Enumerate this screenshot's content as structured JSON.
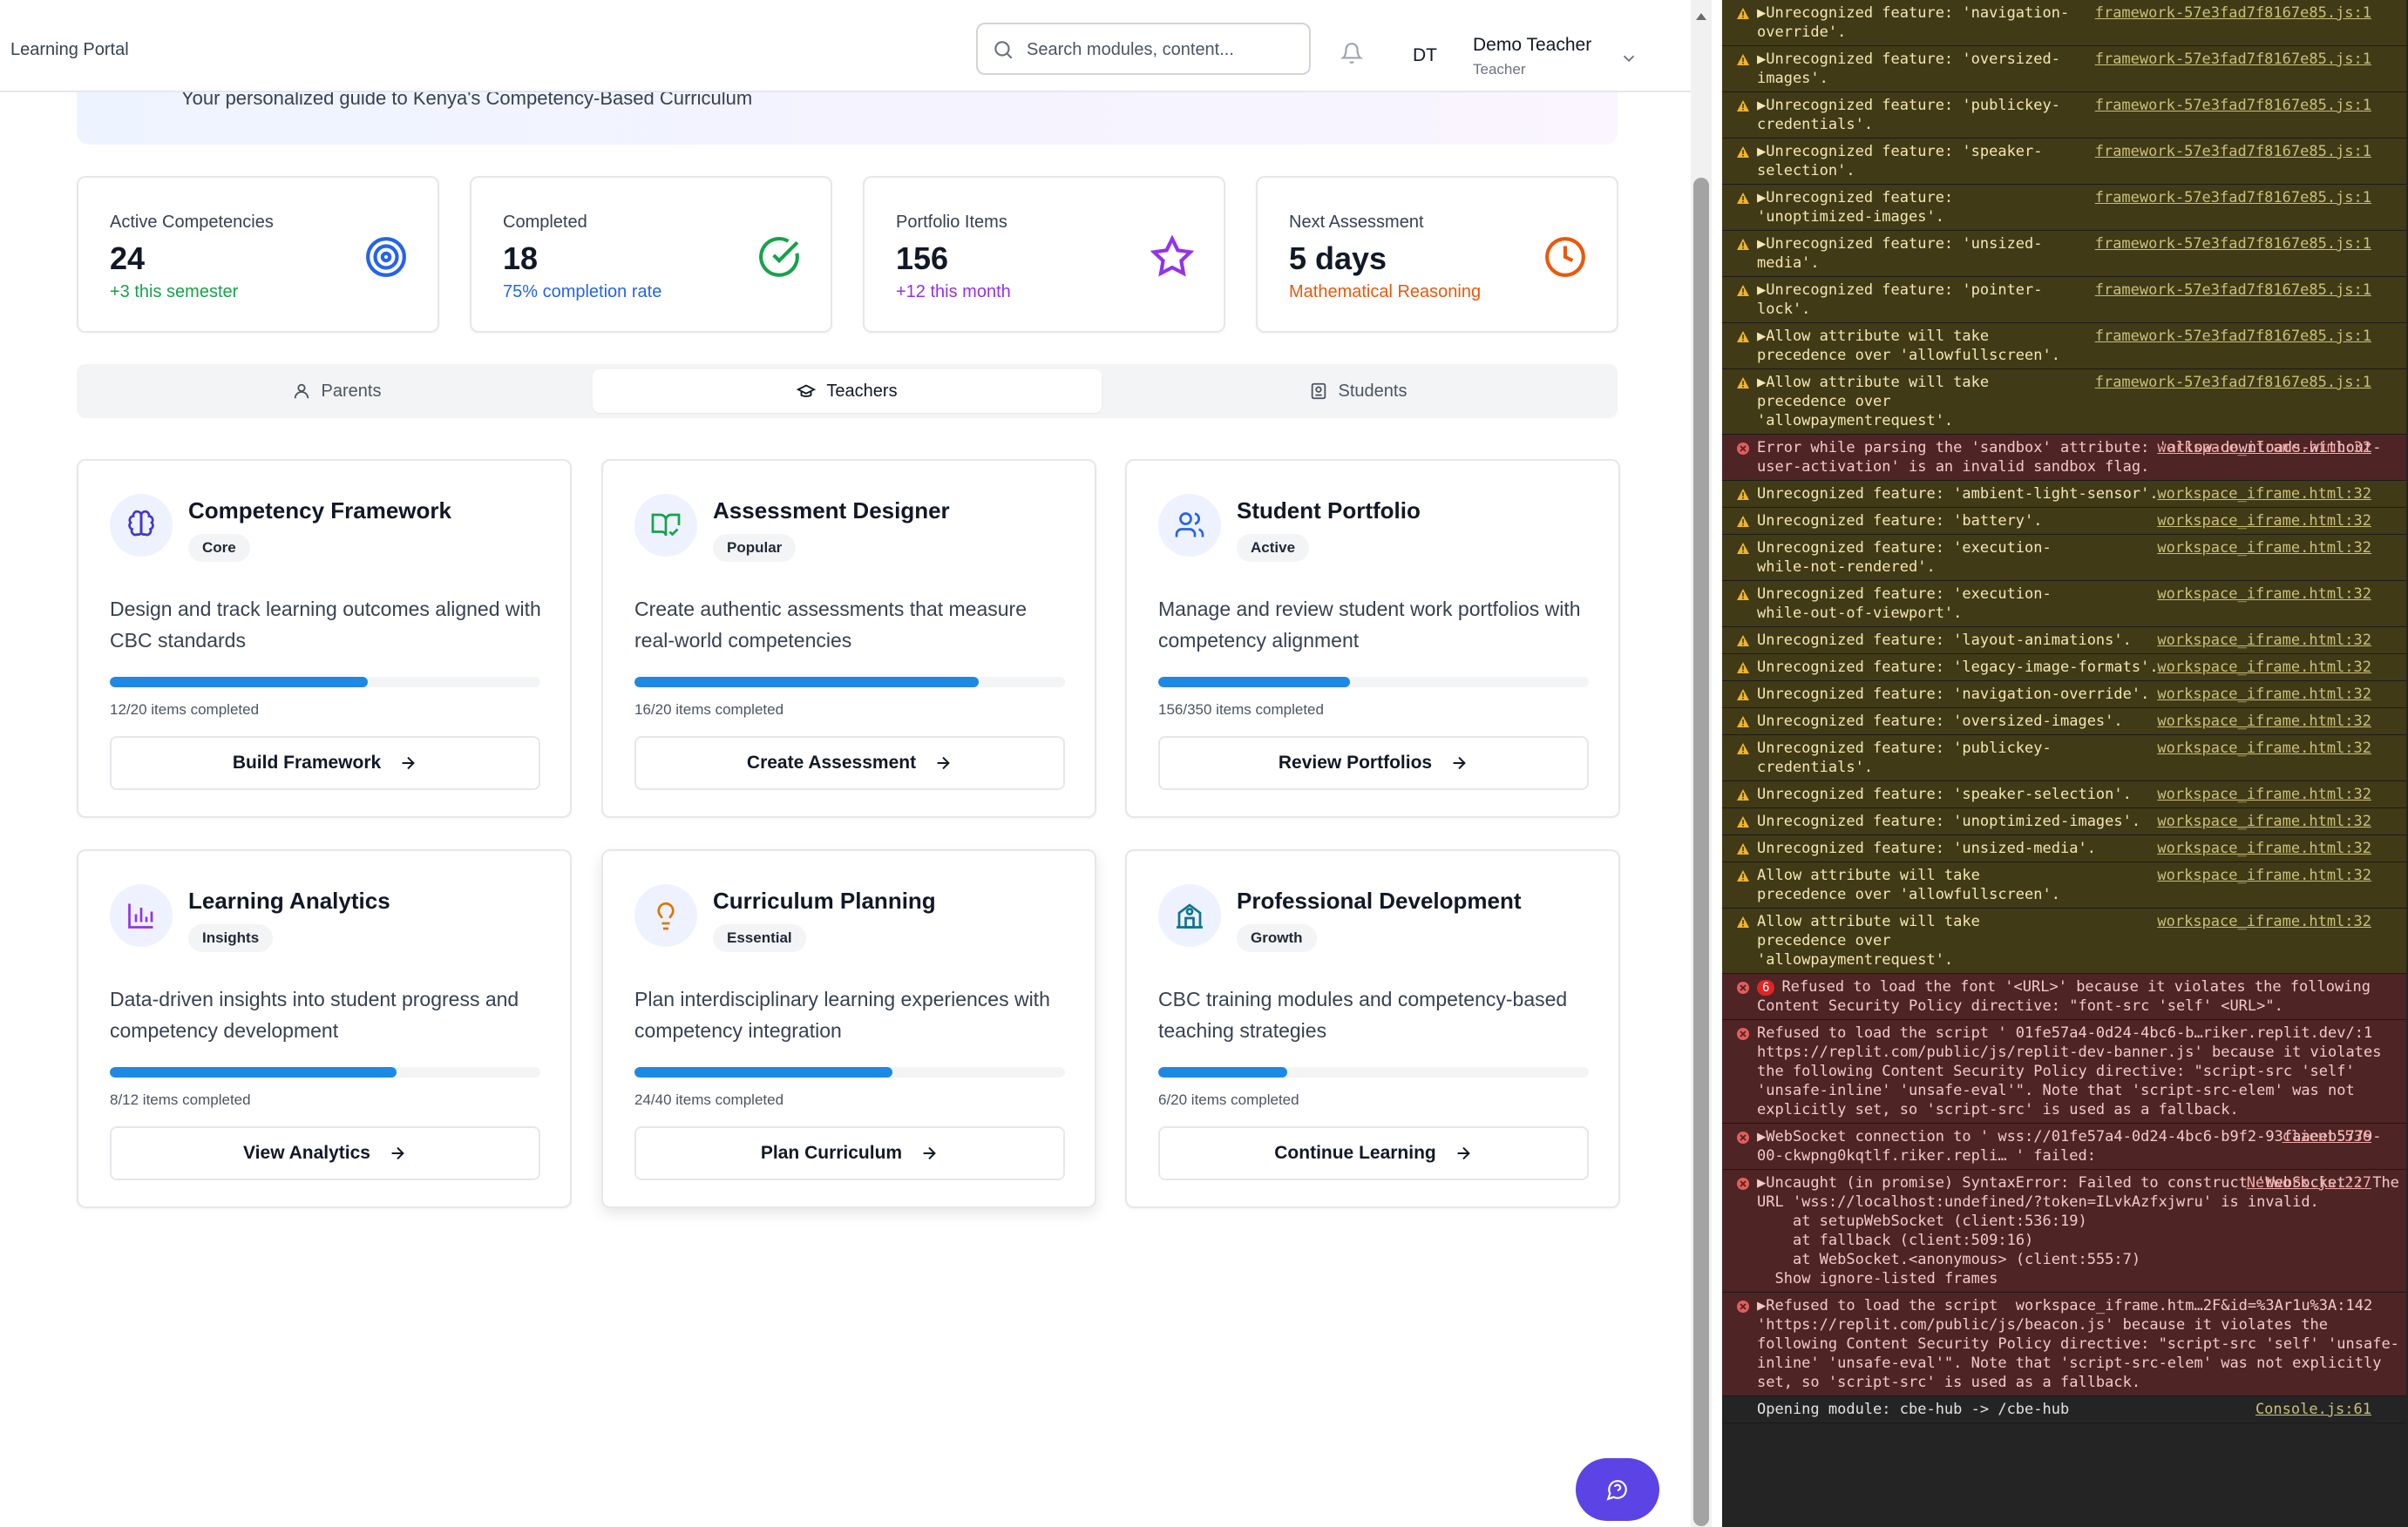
{
  "header": {
    "brand": "Learning Portal",
    "search_placeholder": "Search modules, content...",
    "user_initials": "DT",
    "user_name": "Demo Teacher",
    "user_role": "Teacher"
  },
  "hero": {
    "subtitle": "Your personalized guide to Kenya's Competency-Based Curriculum"
  },
  "stats": [
    {
      "label": "Active Competencies",
      "value": "24",
      "sub": "+3 this semester",
      "sub_color": "#16a34a",
      "icon": "target-icon",
      "icon_color": "#2563eb"
    },
    {
      "label": "Completed",
      "value": "18",
      "sub": "75% completion rate",
      "sub_color": "#2563eb",
      "icon": "check-circle-icon",
      "icon_color": "#16a34a"
    },
    {
      "label": "Portfolio Items",
      "value": "156",
      "sub": "+12 this month",
      "sub_color": "#9333ea",
      "icon": "star-icon",
      "icon_color": "#9333ea"
    },
    {
      "label": "Next Assessment",
      "value": "5 days",
      "sub": "Mathematical Reasoning",
      "sub_color": "#ea580c",
      "icon": "clock-icon",
      "icon_color": "#ea580c"
    }
  ],
  "tabs": [
    {
      "label": "Parents",
      "active": false
    },
    {
      "label": "Teachers",
      "active": true
    },
    {
      "label": "Students",
      "active": false
    }
  ],
  "modules": [
    {
      "title": "Competency Framework",
      "badge": "Core",
      "desc": "Design and track learning outcomes aligned with CBC standards",
      "progress": 0.6,
      "progress_text": "12/20 items completed",
      "button": "Build Framework",
      "icon": "brain-icon",
      "icon_color": "#4338ca"
    },
    {
      "title": "Assessment Designer",
      "badge": "Popular",
      "desc": "Create authentic assessments that measure real-world competencies",
      "progress": 0.8,
      "progress_text": "16/20 items completed",
      "button": "Create Assessment",
      "icon": "book-check-icon",
      "icon_color": "#16a34a"
    },
    {
      "title": "Student Portfolio",
      "badge": "Active",
      "desc": "Manage and review student work portfolios with competency alignment",
      "progress": 0.4457,
      "progress_text": "156/350 items completed",
      "button": "Review Portfolios",
      "icon": "users-icon",
      "icon_color": "#2563eb"
    },
    {
      "title": "Learning Analytics",
      "badge": "Insights",
      "desc": "Data-driven insights into student progress and competency development",
      "progress": 0.6667,
      "progress_text": "8/12 items completed",
      "button": "View Analytics",
      "icon": "bar-chart-icon",
      "icon_color": "#9333ea"
    },
    {
      "title": "Curriculum Planning",
      "badge": "Essential",
      "desc": "Plan interdisciplinary learning experiences with competency integration",
      "progress": 0.6,
      "progress_text": "24/40 items completed",
      "button": "Plan Curriculum",
      "icon": "lightbulb-icon",
      "icon_color": "#d97706"
    },
    {
      "title": "Professional Development",
      "badge": "Growth",
      "desc": "CBC training modules and competency-based teaching strategies",
      "progress": 0.3,
      "progress_text": "6/20 items completed",
      "button": "Continue Learning",
      "icon": "school-icon",
      "icon_color": "#0e7490"
    }
  ],
  "console": [
    {
      "level": "warn",
      "msg": "▶Unrecognized feature: 'navigation-override'.",
      "src": "framework-57e3fad7f8167e85.js:1",
      "narrow": true
    },
    {
      "level": "warn",
      "msg": "▶Unrecognized feature: 'oversized-images'.",
      "src": "framework-57e3fad7f8167e85.js:1",
      "narrow": true
    },
    {
      "level": "warn",
      "msg": "▶Unrecognized feature: 'publickey-credentials'.",
      "src": "framework-57e3fad7f8167e85.js:1",
      "narrow": true
    },
    {
      "level": "warn",
      "msg": "▶Unrecognized feature: 'speaker-selection'.",
      "src": "framework-57e3fad7f8167e85.js:1",
      "narrow": true
    },
    {
      "level": "warn",
      "msg": "▶Unrecognized feature: 'unoptimized-images'.",
      "src": "framework-57e3fad7f8167e85.js:1",
      "narrow": true
    },
    {
      "level": "warn",
      "msg": "▶Unrecognized feature: 'unsized-media'.",
      "src": "framework-57e3fad7f8167e85.js:1",
      "narrow": true
    },
    {
      "level": "warn",
      "msg": "▶Unrecognized feature: 'pointer-lock'.",
      "src": "framework-57e3fad7f8167e85.js:1",
      "narrow": true
    },
    {
      "level": "warn",
      "msg": "▶Allow attribute will take precedence over 'allowfullscreen'.",
      "src": "framework-57e3fad7f8167e85.js:1",
      "narrow": true
    },
    {
      "level": "warn",
      "msg": "▶Allow attribute will take precedence over 'allowpaymentrequest'.",
      "src": "framework-57e3fad7f8167e85.js:1",
      "narrow": true
    },
    {
      "level": "err",
      "msg": "Error while parsing the 'sandbox' attribute: 'allow-downloads-without-user-activation' is an invalid sandbox flag.",
      "src": "workspace_iframe.html:32",
      "narrow": false
    },
    {
      "level": "warn",
      "msg": "Unrecognized feature: 'ambient-light-sensor'.",
      "src": "workspace_iframe.html:32",
      "narrow": false
    },
    {
      "level": "warn",
      "msg": "Unrecognized feature: 'battery'.",
      "src": "workspace_iframe.html:32",
      "narrow": false
    },
    {
      "level": "warn",
      "msg": "Unrecognized feature: 'execution-while-not-rendered'.",
      "src": "workspace_iframe.html:32",
      "narrow": true
    },
    {
      "level": "warn",
      "msg": "Unrecognized feature: 'execution-while-out-of-viewport'.",
      "src": "workspace_iframe.html:32",
      "narrow": true
    },
    {
      "level": "warn",
      "msg": "Unrecognized feature: 'layout-animations'.",
      "src": "workspace_iframe.html:32",
      "narrow": false
    },
    {
      "level": "warn",
      "msg": "Unrecognized feature: 'legacy-image-formats'.",
      "src": "workspace_iframe.html:32",
      "narrow": false
    },
    {
      "level": "warn",
      "msg": "Unrecognized feature: 'navigation-override'.",
      "src": "workspace_iframe.html:32",
      "narrow": false
    },
    {
      "level": "warn",
      "msg": "Unrecognized feature: 'oversized-images'.",
      "src": "workspace_iframe.html:32",
      "narrow": false
    },
    {
      "level": "warn",
      "msg": "Unrecognized feature: 'publickey-credentials'.",
      "src": "workspace_iframe.html:32",
      "narrow": true
    },
    {
      "level": "warn",
      "msg": "Unrecognized feature: 'speaker-selection'.",
      "src": "workspace_iframe.html:32",
      "narrow": false
    },
    {
      "level": "warn",
      "msg": "Unrecognized feature: 'unoptimized-images'.",
      "src": "workspace_iframe.html:32",
      "narrow": false
    },
    {
      "level": "warn",
      "msg": "Unrecognized feature: 'unsized-media'.",
      "src": "workspace_iframe.html:32",
      "narrow": false
    },
    {
      "level": "warn",
      "msg": "Allow attribute will take precedence over 'allowfullscreen'.",
      "src": "workspace_iframe.html:32",
      "narrow": true
    },
    {
      "level": "warn",
      "msg": "Allow attribute will take precedence over 'allowpaymentrequest'.",
      "src": "workspace_iframe.html:32",
      "narrow": true
    },
    {
      "level": "err",
      "count": "6",
      "msg": "Refused to load the font '<URL>' because it violates the following Content Security Policy directive: \"font-src 'self' <URL>\".",
      "src": "",
      "narrow": false
    },
    {
      "level": "err",
      "msg": "Refused to load the script ' 01fe57a4-0d24-4bc6-b…riker.replit.dev/:1 https://replit.com/public/js/replit-dev-banner.js' because it violates the following Content Security Policy directive: \"script-src 'self' 'unsafe-inline' 'unsafe-eval'\". Note that 'script-src-elem' was not explicitly set, so 'script-src' is used as a fallback.",
      "src": "",
      "narrow": false
    },
    {
      "level": "err",
      "msg": "▶WebSocket connection to ' wss://01fe57a4-0d24-4bc6-b9f2-93faaeeb5779-00-ckwpng0kqtlf.riker.repli… ' failed:",
      "src": "client:536",
      "narrow": false
    },
    {
      "level": "err",
      "msg": "▶Uncaught (in promise) SyntaxError: Failed to construct 'WebSocket': The URL 'wss://localhost:undefined/?token=ILvkAzfxjwru' is invalid.\n    at setupWebSocket (client:536:19)\n    at fallback (client:509:16)\n    at WebSocket.<anonymous> (client:555:7)\n  Show ignore-listed frames",
      "src": "Network.js:227",
      "narrow": false
    },
    {
      "level": "err",
      "msg": "▶Refused to load the script  workspace_iframe.htm…2F&id=%3Ar1u%3A:142 'https://replit.com/public/js/beacon.js' because it violates the following Content Security Policy directive: \"script-src 'self' 'unsafe-inline' 'unsafe-eval'\". Note that 'script-src-elem' was not explicitly set, so 'script-src' is used as a fallback.",
      "src": "",
      "narrow": false
    },
    {
      "level": "info",
      "msg": "Opening module: cbe-hub -> /cbe-hub",
      "src": "Console.js:61",
      "narrow": false
    }
  ]
}
